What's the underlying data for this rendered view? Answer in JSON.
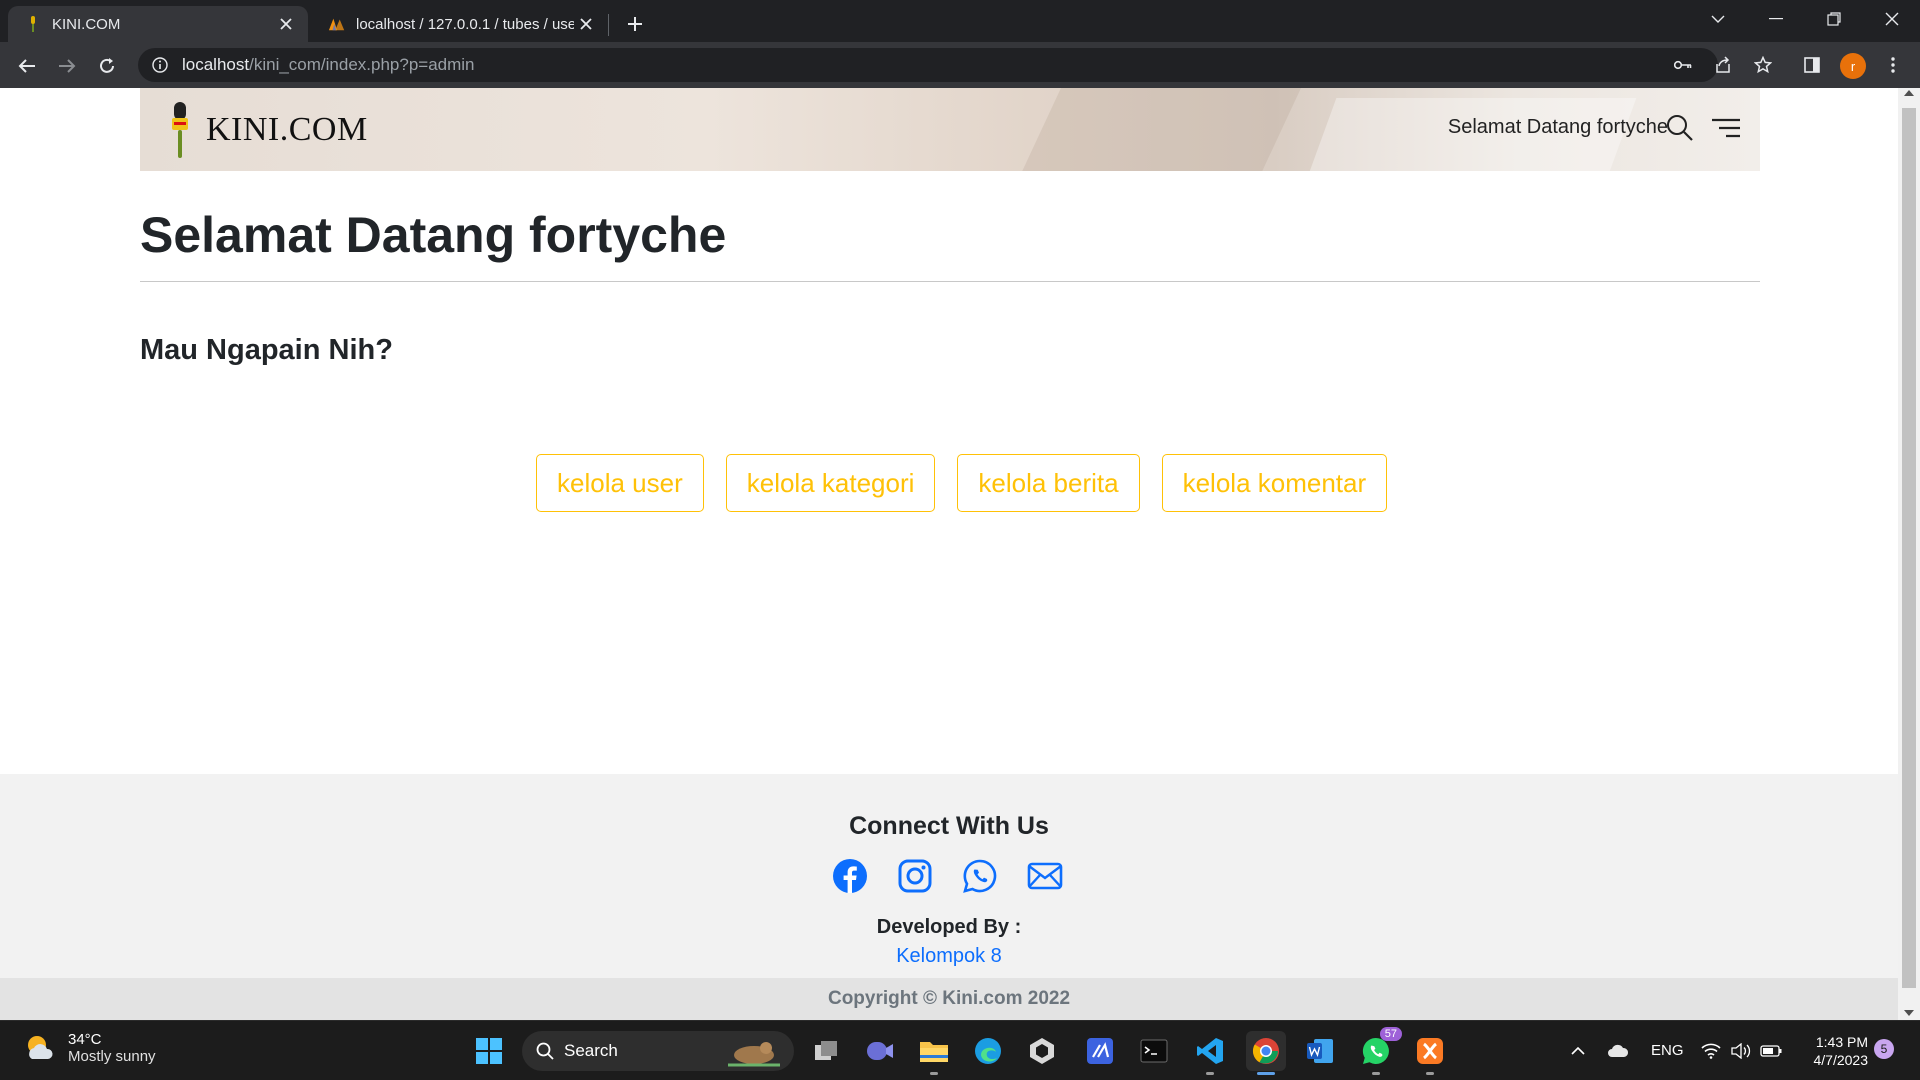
{
  "browser": {
    "tabs": [
      {
        "title": "KINI.COM",
        "active": true
      },
      {
        "title": "localhost / 127.0.0.1 / tubes / use",
        "active": false
      }
    ],
    "url_host": "localhost",
    "url_path": "/kini_com/index.php?p=admin",
    "profile_initial": "r"
  },
  "site": {
    "brand": "KINI.COM",
    "greeting": "Selamat Datang fortyche",
    "page_title": "Selamat Datang fortyche",
    "subtitle": "Mau Ngapain Nih?",
    "actions": [
      "kelola user",
      "kelola kategori",
      "kelola berita",
      "kelola komentar"
    ],
    "accent_color": "#ffc107"
  },
  "footer": {
    "connect": "Connect With Us",
    "socials": [
      "facebook-icon",
      "instagram-icon",
      "whatsapp-icon",
      "mail-icon"
    ],
    "developed_by": "Developed By :",
    "team": "Kelompok 8",
    "copyright": "Copyright © Kini.com 2022"
  },
  "taskbar": {
    "temperature": "34°C",
    "weather": "Mostly sunny",
    "search_label": "Search",
    "whatsapp_badge": "57",
    "language": "ENG",
    "time": "1:43 PM",
    "date": "4/7/2023",
    "notifications": "5"
  }
}
